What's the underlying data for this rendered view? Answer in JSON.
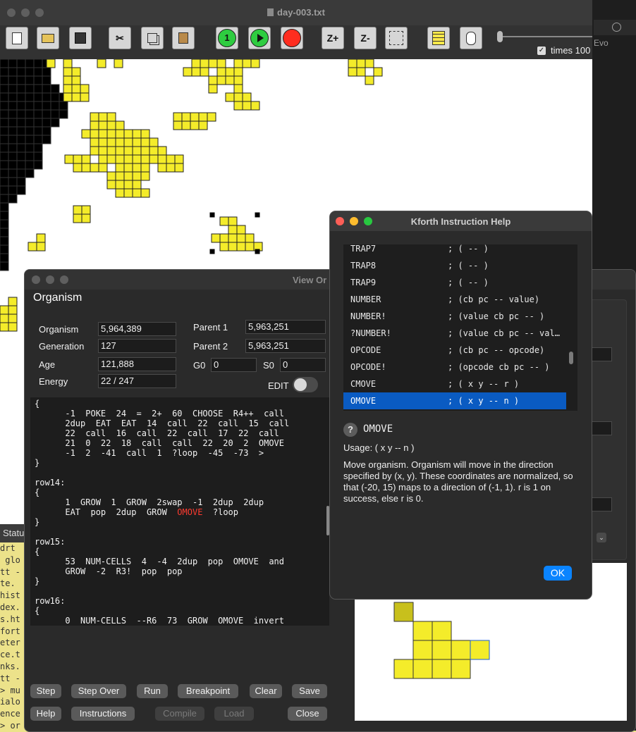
{
  "main_window": {
    "title": "day-003.txt",
    "times_label": "times 100",
    "toolbar": {
      "step1_label": "1",
      "zoom_in_label": "Z+",
      "zoom_out_label": "Z-"
    }
  },
  "background_window": {
    "tab_label": "Evo"
  },
  "organism_window": {
    "title": "View Or",
    "heading": "Organism",
    "fields": {
      "organism_label": "Organism",
      "organism_value": "5,964,389",
      "generation_label": "Generation",
      "generation_value": "127",
      "age_label": "Age",
      "age_value": "121,888",
      "energy_label": "Energy",
      "energy_value": "22 / 247",
      "parent1_label": "Parent 1",
      "parent1_value": "5,963,251",
      "parent2_label": "Parent 2",
      "parent2_value": "5,963,251",
      "g0_label": "G0",
      "g0_value": "0",
      "s0_label": "S0",
      "s0_value": "0",
      "edit_label": "EDIT"
    },
    "code": {
      "before_highlight": "{\n      -1  POKE  24  =  2+  60  CHOOSE  R4++  call\n      2dup  EAT  EAT  14  call  22  call  15  call\n      22  call  16  call  22  call  17  22  call\n      21  0  22  18  call  call  22  20  2  OMOVE\n      -1  2  -41  call  1  ?loop  -45  -73  >\n}\n\nrow14:\n{\n      1  GROW  1  GROW  2swap  -1  2dup  2dup\n      EAT  pop  2dup  GROW  ",
      "highlight": "OMOVE",
      "after_highlight": "  ?loop\n}\n\nrow15:\n{\n      53  NUM-CELLS  4  -4  2dup  pop  OMOVE  and\n      GROW  -2  R3!  pop  pop\n}\n\nrow16:\n{\n      0  NUM-CELLS  --R6  73  GROW  OMOVE  invert"
    },
    "buttons": {
      "step": "Step",
      "step_over": "Step Over",
      "run": "Run",
      "breakpoint": "Breakpoint",
      "clear": "Clear",
      "save": "Save",
      "help": "Help",
      "instructions": "Instructions",
      "compile": "Compile",
      "load": "Load",
      "close": "Close"
    }
  },
  "status_tab": {
    "label": "Statu"
  },
  "terminal": {
    "lines": [
      "drt",
      " glo",
      "tt -",
      "te.",
      "hist",
      "dex.",
      "s.ht",
      "fort",
      "eter",
      "ce.t",
      "nks.",
      "tt -",
      "> mu",
      "ialo",
      "ence",
      "> or"
    ]
  },
  "help_window": {
    "title": "Kforth Instruction Help",
    "instructions": [
      {
        "name": "TRAP7",
        "sig": "; ( -- )"
      },
      {
        "name": "TRAP8",
        "sig": "; ( -- )"
      },
      {
        "name": "TRAP9",
        "sig": "; ( -- )"
      },
      {
        "name": "NUMBER",
        "sig": "; (cb pc -- value)"
      },
      {
        "name": "NUMBER!",
        "sig": "; (value cb pc -- )"
      },
      {
        "name": "?NUMBER!",
        "sig": "; (value cb pc -- val…"
      },
      {
        "name": "OPCODE",
        "sig": "; (cb pc -- opcode)"
      },
      {
        "name": "OPCODE!",
        "sig": "; (opcode cb pc -- )"
      },
      {
        "name": "CMOVE",
        "sig": "; ( x y -- r )"
      },
      {
        "name": "OMOVE",
        "sig": "; ( x y -- n )"
      }
    ],
    "selected": "OMOVE",
    "help_icon": "?",
    "word": "OMOVE",
    "usage": "Usage: ( x y -- n )",
    "description": "Move organism. Organism will move in the direction specified by (x, y). These coordinates are normalized, so that (-20, 15) maps to a direction of (-1, 1). r is 1 on success, else r is 0.",
    "ok": "OK"
  }
}
